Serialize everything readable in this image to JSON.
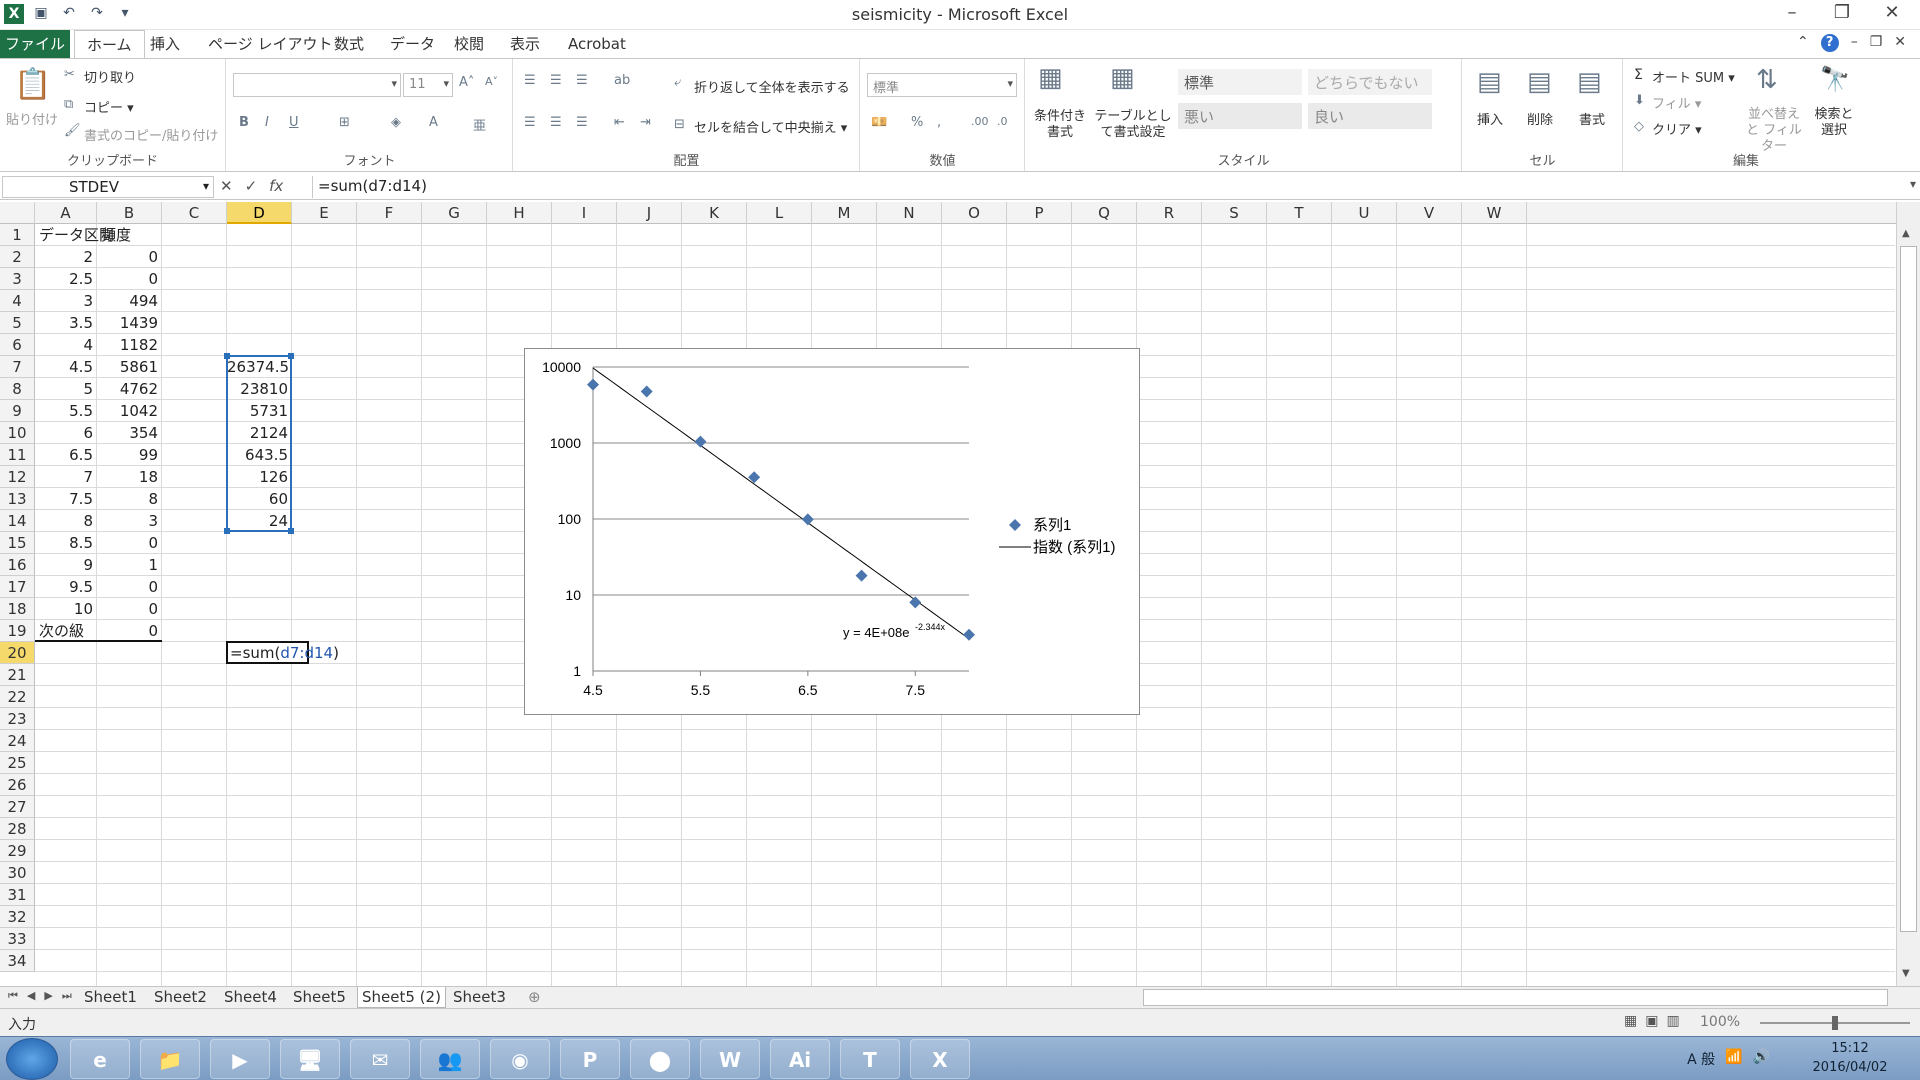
{
  "window": {
    "title": "seismicity - Microsoft Excel",
    "app_icon": "X",
    "qat": [
      "save-icon",
      "undo-icon",
      "redo-icon",
      "customize-icon"
    ]
  },
  "tabs": [
    "ファイル",
    "ホーム",
    "挿入",
    "ページ レイアウト",
    "数式",
    "データ",
    "校閲",
    "表示",
    "Acrobat"
  ],
  "active_tab": "ホーム",
  "ribbon": {
    "clipboard": {
      "label": "クリップボード",
      "paste": "貼り付け",
      "cut": "切り取り",
      "copy": "コピー ▾",
      "format_painter": "書式のコピー/貼り付け"
    },
    "font": {
      "label": "フォント",
      "font_name": "",
      "font_size": "11"
    },
    "alignment": {
      "label": "配置",
      "wrap": "折り返して全体を表示する",
      "merge": "セルを結合して中央揃え ▾"
    },
    "number": {
      "label": "数値",
      "format": "標準"
    },
    "styles": {
      "label": "スタイル",
      "conditional": "条件付き書式",
      "table": "テーブルとして書式設定",
      "standard": "標準",
      "neutral": "どちらでもない",
      "bad": "悪い",
      "good": "良い"
    },
    "cells": {
      "label": "セル",
      "insert": "挿入",
      "delete": "削除",
      "format": "書式"
    },
    "editing": {
      "label": "編集",
      "autosum": "オート SUM ▾",
      "fill": "フィル ▾",
      "clear": "クリア ▾",
      "sort": "並べ替えと フィルター",
      "find": "検索と 選択"
    }
  },
  "formula_bar": {
    "name_box": "STDEV",
    "formula": "=sum(d7:d14)"
  },
  "columns": [
    "A",
    "B",
    "C",
    "D",
    "E",
    "F",
    "G",
    "H",
    "I",
    "J",
    "K",
    "L",
    "M",
    "N",
    "O",
    "P",
    "Q",
    "R",
    "S",
    "T",
    "U",
    "V",
    "W"
  ],
  "rows": [
    "1",
    "2",
    "3",
    "4",
    "5",
    "6",
    "7",
    "8",
    "9",
    "10",
    "11",
    "12",
    "13",
    "14",
    "15",
    "16",
    "17",
    "18",
    "19",
    "20",
    "21",
    "22",
    "23",
    "24",
    "25",
    "26",
    "27",
    "28",
    "29",
    "30",
    "31",
    "32",
    "33",
    "34"
  ],
  "colA": [
    "データ区間",
    "2",
    "2.5",
    "3",
    "3.5",
    "4",
    "4.5",
    "5",
    "5.5",
    "6",
    "6.5",
    "7",
    "7.5",
    "8",
    "8.5",
    "9",
    "9.5",
    "10",
    "次の級"
  ],
  "colB": [
    "頻度",
    "0",
    "0",
    "494",
    "1439",
    "1182",
    "5861",
    "4762",
    "1042",
    "354",
    "99",
    "18",
    "8",
    "3",
    "0",
    "1",
    "0",
    "0",
    "0"
  ],
  "colD": [
    "26374.5",
    "23810",
    "5731",
    "2124",
    "643.5",
    "126",
    "60",
    "24"
  ],
  "active_cell": {
    "prefix": "=sum(",
    "ref": "d7:d14",
    "suffix": ")"
  },
  "chart_data": {
    "type": "scatter",
    "x": [
      4.5,
      5,
      5.5,
      6,
      6.5,
      7,
      7.5,
      8
    ],
    "series": [
      {
        "name": "系列1",
        "values": [
          5861,
          4762,
          1042,
          354,
          99,
          18,
          8,
          3
        ]
      }
    ],
    "trendline": {
      "name": "指数 (系列1)",
      "equation": "y = 4E+08e",
      "exponent": "-2.344x"
    },
    "xticks": [
      "4.5",
      "5.5",
      "6.5",
      "7.5"
    ],
    "yticks": [
      "10000",
      "1000",
      "100",
      "10",
      "1"
    ],
    "xlim": [
      4.5,
      8
    ],
    "ylim": [
      1,
      10000
    ],
    "yscale": "log",
    "legend": "right",
    "marker_color": "#4a76ad"
  },
  "sheets": [
    "Sheet1",
    "Sheet2",
    "Sheet4",
    "Sheet5",
    "Sheet5 (2)",
    "Sheet3"
  ],
  "active_sheet": "Sheet5 (2)",
  "status": {
    "mode": "入力",
    "zoom": "100%"
  },
  "taskbar": {
    "apps": [
      "e",
      "📁",
      "▶",
      "🖥",
      "✉",
      "👥",
      "◉",
      "P",
      "⬤",
      "W",
      "Ai",
      "T",
      "X"
    ],
    "time": "15:12",
    "date": "2016/04/02",
    "ime": "A 般"
  }
}
